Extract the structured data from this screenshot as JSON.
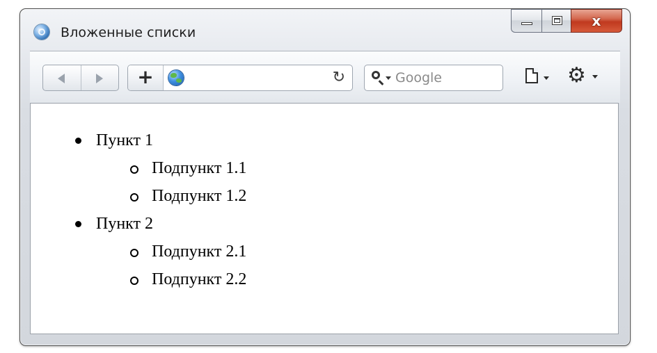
{
  "window": {
    "title": "Вложенные списки",
    "close_glyph": "x"
  },
  "toolbar": {
    "add_tab_glyph": "+",
    "reload_glyph": "↻",
    "search_placeholder": "Google",
    "gear_glyph": "⚙"
  },
  "content": {
    "items": [
      {
        "label": "Пункт 1",
        "children": [
          "Подпункт 1.1",
          "Подпункт 1.2"
        ]
      },
      {
        "label": "Пункт 2",
        "children": [
          "Подпункт 2.1",
          "Подпункт 2.2"
        ]
      }
    ]
  },
  "icons": {
    "app": "globe-icon",
    "back": "back-arrow-icon",
    "forward": "forward-arrow-icon",
    "address_site": "globe-icon",
    "reload": "reload-icon",
    "search": "search-icon",
    "page": "page-icon",
    "tools": "gear-icon"
  },
  "colors": {
    "close_button": "#c0391f",
    "frame": "#d9dde3",
    "page_background": "#ffffff"
  }
}
